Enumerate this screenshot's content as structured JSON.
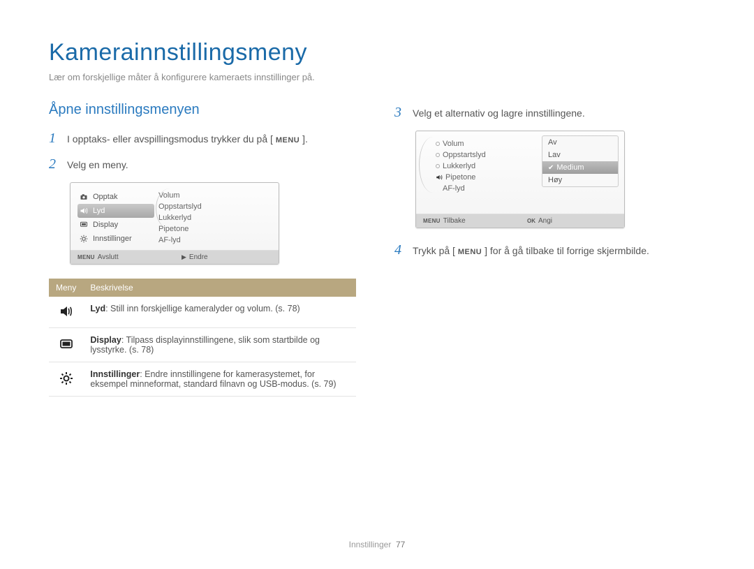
{
  "page_title": "Kamerainnstillingsmeny",
  "subtitle": "Lær om forskjellige måter å konfigurere kameraets innstillinger på.",
  "left": {
    "heading": "Åpne innstillingsmenyen",
    "step1_before": "I opptaks- eller avspillingsmodus trykker du på [",
    "step1_menu": "MENU",
    "step1_after": "].",
    "step2": "Velg en meny.",
    "device1": {
      "left_items": [
        {
          "label": "Opptak",
          "icon": "camera",
          "active": false
        },
        {
          "label": "Lyd",
          "icon": "sound",
          "active": true
        },
        {
          "label": "Display",
          "icon": "display",
          "active": false
        },
        {
          "label": "Innstillinger",
          "icon": "gear",
          "active": false
        }
      ],
      "right_items": [
        "Volum",
        "Oppstartslyd",
        "Lukkerlyd",
        "Pipetone",
        "AF-lyd"
      ],
      "footer_left_badge": "MENU",
      "footer_left": "Avslutt",
      "footer_right_tri": "▶",
      "footer_right": "Endre"
    },
    "table": {
      "head_meny": "Meny",
      "head_beskrivelse": "Beskrivelse",
      "rows": [
        {
          "icon": "sound",
          "bold": "Lyd",
          "rest": ": Still inn forskjellige kameralyder og volum. (s. 78)"
        },
        {
          "icon": "display",
          "bold": "Display",
          "rest": ": Tilpass displayinnstillingene, slik som startbilde og lysstyrke. (s. 78)"
        },
        {
          "icon": "gear",
          "bold": "Innstillinger",
          "rest": ": Endre innstillingene for kamerasystemet, for eksempel minneformat, standard filnavn og USB-modus. (s. 79)"
        }
      ]
    }
  },
  "right": {
    "step3": "Velg et alternativ og lagre innstillingene.",
    "device2": {
      "right_items": [
        {
          "label": "Volum",
          "icon": ""
        },
        {
          "label": "Oppstartslyd",
          "icon": ""
        },
        {
          "label": "Lukkerlyd",
          "icon": ""
        },
        {
          "label": "Pipetone",
          "icon": "sound"
        },
        {
          "label": "AF-lyd",
          "icon": ""
        }
      ],
      "options": [
        {
          "label": "Av",
          "active": false,
          "checked": false
        },
        {
          "label": "Lav",
          "active": false,
          "checked": false
        },
        {
          "label": "Medium",
          "active": true,
          "checked": true
        },
        {
          "label": "Høy",
          "active": false,
          "checked": false
        }
      ],
      "footer_left_badge": "MENU",
      "footer_left": "Tilbake",
      "footer_right_badge": "OK",
      "footer_right": "Angi"
    },
    "step4_before": "Trykk på [",
    "step4_menu": "MENU",
    "step4_after": "] for å gå tilbake til forrige skjermbilde."
  },
  "footer": {
    "section": "Innstillinger",
    "page": "77"
  },
  "step_numbers": {
    "s1": "1",
    "s2": "2",
    "s3": "3",
    "s4": "4"
  }
}
